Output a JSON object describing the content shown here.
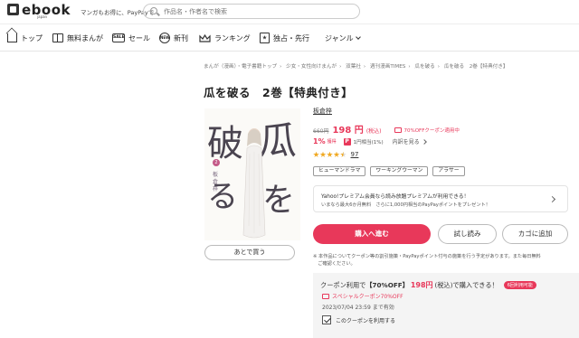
{
  "header": {
    "logo_text": "ebook",
    "logo_sub": "japan",
    "tagline": "マンガもお得に、PayPayで",
    "search": {
      "placeholder": "作品名・作者名で検索"
    }
  },
  "nav": {
    "items": [
      {
        "label": "トップ"
      },
      {
        "label": "無料まんが"
      },
      {
        "label": "セール"
      },
      {
        "label": "新刊"
      },
      {
        "label": "ランキング"
      },
      {
        "label": "独占・先行"
      },
      {
        "label": "ジャンル"
      }
    ],
    "sale_icon_text": "SALE",
    "new_icon_text": "NEW"
  },
  "breadcrumb": [
    "まんが（漫画）・電子書籍トップ",
    "少女・女性向けまんが",
    "双葉社",
    "週刊漫画TIMES",
    "瓜を破る",
    "瓜を破る　2巻【特典付き】"
  ],
  "product": {
    "title": "瓜を破る　2巻【特典付き】",
    "cover": {
      "k1": "破",
      "k2": "瓜",
      "k3": "る",
      "k4": "を",
      "vol": "2",
      "author_vertical": "板倉梓"
    },
    "later_button": "あとで買う",
    "author": "板倉梓",
    "orig_price": "660円",
    "price": "198 円",
    "tax_in": "(税込)",
    "coupon_tag": "70%OFFクーポン適用中",
    "points": "1%",
    "points_suffix": "獲得",
    "points_pay_label": "1円相当(1%)",
    "points_detail": "内訳を見る",
    "rating": 4.5,
    "reviews": "97",
    "tags": [
      "ヒューマンドラマ",
      "ワーキングウーマン",
      "アラサー"
    ]
  },
  "yahoo": {
    "line1": "Yahoo!プレミアム会員なら読み放題プレミアムが利用できる！",
    "line2": "いまなら最大6か月無料　さらに1,000円相当のPayPayポイントをプレゼント！"
  },
  "actions": {
    "buy": "購入へ進む",
    "trial": "試し読み",
    "cart": "カゴに追加"
  },
  "notice": "※ 本作品についてクーポン等の割引施策・PayPayポイント付与の施策を行う予定があります。また毎日無料",
  "notice2": "　ご確認ください。",
  "coupon": {
    "title_prefix": "クーポン利用で",
    "title_off": "【70%OFF】",
    "price": "198円",
    "title_suffix": "(税込)で購入できる！",
    "badge": "6回利用可能",
    "name": "スペシャルクーポン70%OFF",
    "expiry": "2023/07/04 23:59 まで有効",
    "use_label": "このクーポンを利用する"
  },
  "colors": {
    "accent": "#e8385a",
    "star": "#f0a820"
  }
}
